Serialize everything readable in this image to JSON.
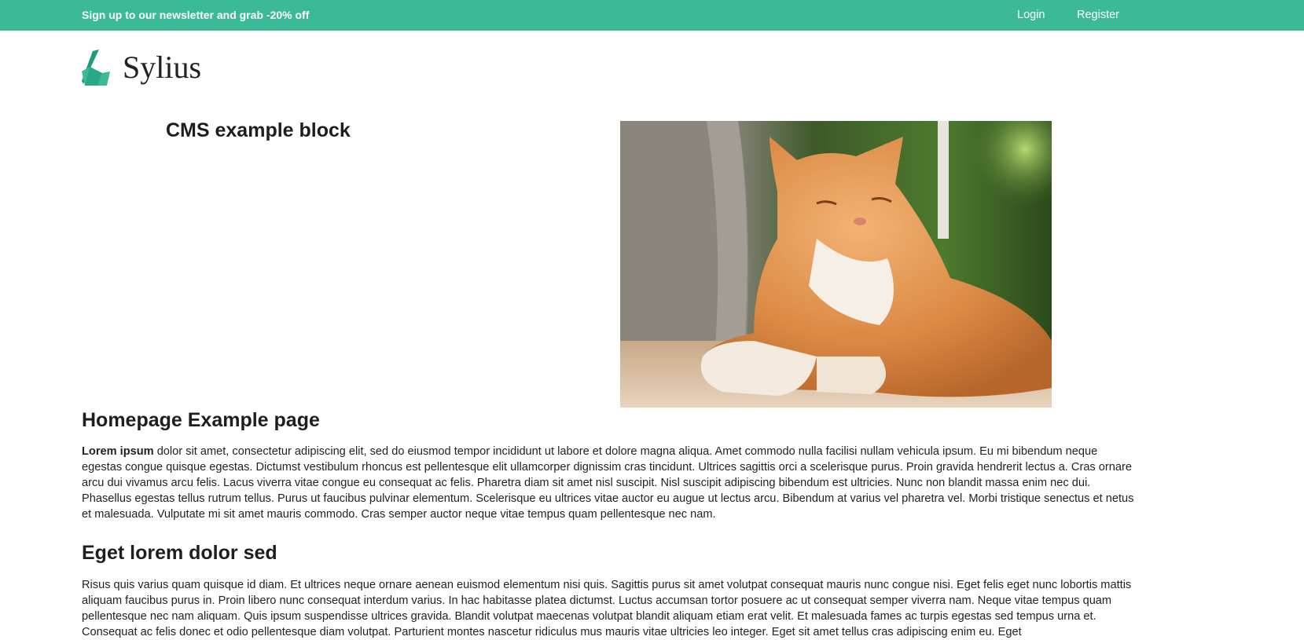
{
  "topbar": {
    "promo": "Sign up to our newsletter and grab -20% off",
    "login": "Login",
    "register": "Register",
    "color": "#3cb996"
  },
  "logo": {
    "text": "Sylius",
    "icon": "sylius-swan-icon"
  },
  "cms_block": {
    "title": "CMS example block",
    "image": "orange-cat-photo"
  },
  "page": {
    "title": "Homepage Example page",
    "intro_bold": "Lorem ipsum",
    "intro_text": " dolor sit amet, consectetur adipiscing elit, sed do eiusmod tempor incididunt ut labore et dolore magna aliqua. Amet commodo nulla facilisi nullam vehicula ipsum. Eu mi bibendum neque egestas congue quisque egestas. Dictumst vestibulum rhoncus est pellentesque elit ullamcorper dignissim cras tincidunt. Ultrices sagittis orci a scelerisque purus. Proin gravida hendrerit lectus a. Cras ornare arcu dui vivamus arcu felis. Lacus viverra vitae congue eu consequat ac felis. Pharetra diam sit amet nisl suscipit. Nisl suscipit adipiscing bibendum est ultricies. Nunc non blandit massa enim nec dui. Phasellus egestas tellus rutrum tellus. Purus ut faucibus pulvinar elementum. Scelerisque eu ultrices vitae auctor eu augue ut lectus arcu. Bibendum at varius vel pharetra vel. Morbi tristique senectus et netus et malesuada. Vulputate mi sit amet mauris commodo. Cras semper auctor neque vitae tempus quam pellentesque nec nam.",
    "section_title": "Eget lorem dolor sed",
    "section_text": "Risus quis varius quam quisque id diam. Et ultrices neque ornare aenean euismod elementum nisi quis. Sagittis purus sit amet volutpat consequat mauris nunc congue nisi. Eget felis eget nunc lobortis mattis aliquam faucibus purus in. Proin libero nunc consequat interdum varius. In hac habitasse platea dictumst. Luctus accumsan tortor posuere ac ut consequat semper viverra nam. Neque vitae tempus quam pellentesque nec nam aliquam. Quis ipsum suspendisse ultrices gravida. Blandit volutpat maecenas volutpat blandit aliquam etiam erat velit. Et malesuada fames ac turpis egestas sed tempus urna et. Consequat ac felis donec et odio pellentesque diam volutpat. Parturient montes nascetur ridiculus mus mauris vitae ultricies leo integer. Eget sit amet tellus cras adipiscing enim eu. Eget"
  }
}
